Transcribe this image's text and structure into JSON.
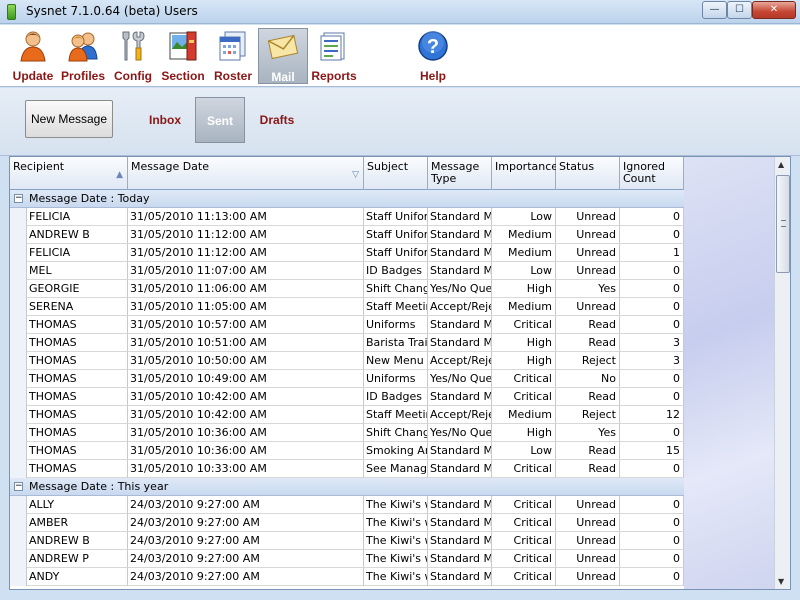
{
  "window": {
    "title": "Sysnet 7.1.0.64 (beta)  Users",
    "min": "—",
    "max": "☐",
    "close": "✕"
  },
  "toolbar": {
    "items": [
      {
        "label": "Update",
        "icon": "user-update-icon"
      },
      {
        "label": "Profiles",
        "icon": "profiles-icon"
      },
      {
        "label": "Config",
        "icon": "config-tools-icon"
      },
      {
        "label": "Section",
        "icon": "section-icon"
      },
      {
        "label": "Roster",
        "icon": "roster-icon"
      },
      {
        "label": "Mail",
        "icon": "mail-icon",
        "active": true
      },
      {
        "label": "Reports",
        "icon": "reports-icon"
      },
      {
        "label": "Help",
        "icon": "help-icon"
      }
    ]
  },
  "mail": {
    "new_message": "New Message",
    "tabs": [
      {
        "label": "Inbox"
      },
      {
        "label": "Sent",
        "active": true
      },
      {
        "label": "Drafts"
      }
    ]
  },
  "grid": {
    "columns": [
      "Recipient",
      "Message Date",
      "Subject",
      "Message Type",
      "Importance",
      "Status",
      "Ignored Count"
    ],
    "groups": [
      {
        "label": "Message Date : Today",
        "rows": [
          [
            "FELICIA",
            "31/05/2010 11:13:00 AM",
            "Staff Uniform",
            "Standard Message",
            "Low",
            "Unread",
            "0"
          ],
          [
            "ANDREW B",
            "31/05/2010 11:12:00 AM",
            "Staff Uniform",
            "Standard Message",
            "Medium",
            "Unread",
            "0"
          ],
          [
            "FELICIA",
            "31/05/2010 11:12:00 AM",
            "Staff Uniform",
            "Standard Message",
            "Medium",
            "Unread",
            "1"
          ],
          [
            "MEL",
            "31/05/2010 11:07:00 AM",
            "ID Badges",
            "Standard Message",
            "Low",
            "Unread",
            "0"
          ],
          [
            "GEORGIE",
            "31/05/2010 11:06:00 AM",
            "Shift Change",
            "Yes/No Question",
            "High",
            "Yes",
            "0"
          ],
          [
            "SERENA",
            "31/05/2010 11:05:00 AM",
            "Staff Meeting",
            "Accept/Reject",
            "Medium",
            "Unread",
            "0"
          ],
          [
            "THOMAS",
            "31/05/2010 10:57:00 AM",
            "Uniforms",
            "Standard Message",
            "Critical",
            "Read",
            "0"
          ],
          [
            "THOMAS",
            "31/05/2010 10:51:00 AM",
            "Barista Training",
            "Standard Message",
            "High",
            "Read",
            "3"
          ],
          [
            "THOMAS",
            "31/05/2010 10:50:00 AM",
            "New Menu T",
            "Accept/Reject",
            "High",
            "Reject",
            "3"
          ],
          [
            "THOMAS",
            "31/05/2010 10:49:00 AM",
            "Uniforms",
            "Yes/No Question",
            "Critical",
            "No",
            "0"
          ],
          [
            "THOMAS",
            "31/05/2010 10:42:00 AM",
            "ID Badges",
            "Standard Message",
            "Critical",
            "Read",
            "0"
          ],
          [
            "THOMAS",
            "31/05/2010 10:42:00 AM",
            "Staff Meeting",
            "Accept/Reject",
            "Medium",
            "Reject",
            "12"
          ],
          [
            "THOMAS",
            "31/05/2010 10:36:00 AM",
            "Shift Change",
            "Yes/No Question",
            "High",
            "Yes",
            "0"
          ],
          [
            "THOMAS",
            "31/05/2010 10:36:00 AM",
            "Smoking Area",
            "Standard Message",
            "Low",
            "Read",
            "15"
          ],
          [
            "THOMAS",
            "31/05/2010 10:33:00 AM",
            "See Manager",
            "Standard Message",
            "Critical",
            "Read",
            "0"
          ]
        ]
      },
      {
        "label": "Message Date : This year",
        "rows": [
          [
            "ALLY",
            "24/03/2010 9:27:00 AM",
            "The Kiwi's wi",
            "Standard Message",
            "Critical",
            "Unread",
            "0"
          ],
          [
            "AMBER",
            "24/03/2010 9:27:00 AM",
            "The Kiwi's wi",
            "Standard Message",
            "Critical",
            "Unread",
            "0"
          ],
          [
            "ANDREW B",
            "24/03/2010 9:27:00 AM",
            "The Kiwi's wi",
            "Standard Message",
            "Critical",
            "Unread",
            "0"
          ],
          [
            "ANDREW P",
            "24/03/2010 9:27:00 AM",
            "The Kiwi's wi",
            "Standard Message",
            "Critical",
            "Unread",
            "0"
          ],
          [
            "ANDY",
            "24/03/2010 9:27:00 AM",
            "The Kiwi's wi",
            "Standard Message",
            "Critical",
            "Unread",
            "0"
          ]
        ]
      }
    ]
  }
}
